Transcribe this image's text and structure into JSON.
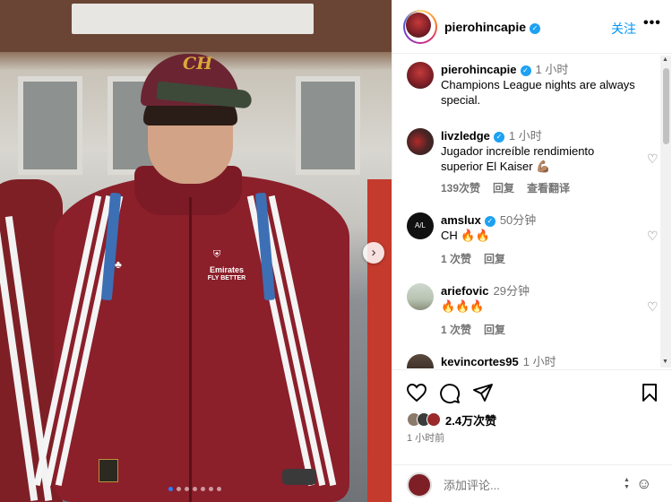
{
  "post": {
    "username": "pierohincapie",
    "follow_label": "关注",
    "more_label": "•••",
    "caption": {
      "username": "pierohincapie",
      "time": "1 小时",
      "text": "Champions League nights are always special."
    },
    "comments": [
      {
        "username": "livzledge",
        "verified": true,
        "time": "1 小时",
        "text": "Jugador increíble rendimiento superior El Kaiser 💪🏽",
        "likes": "139次赞",
        "reply": "回复",
        "translate": "查看翻译"
      },
      {
        "username": "amslux",
        "verified": true,
        "time": "50分钟",
        "text": "CH 🔥🔥",
        "likes": "1 次赞",
        "reply": "回复",
        "avatar_text": "A/L"
      },
      {
        "username": "ariefovic",
        "verified": false,
        "time": "29分钟",
        "text": "🔥🔥🔥",
        "likes": "1 次赞",
        "reply": "回复"
      },
      {
        "username": "kevincortes95",
        "verified": false,
        "time": "1 小时"
      }
    ],
    "likes_total": "2.4万次赞",
    "post_time": "1 小时前",
    "comment_placeholder": "添加评论...",
    "photo": {
      "cap_logo": "CH",
      "sponsor_line1": "Emirates",
      "sponsor_line2": "FLY BETTER",
      "slide_count": 7,
      "active_slide": 0
    }
  },
  "colors": {
    "accent": "#0095f6",
    "verified": "#1da1f2",
    "jacket": "#8b1f2a"
  }
}
